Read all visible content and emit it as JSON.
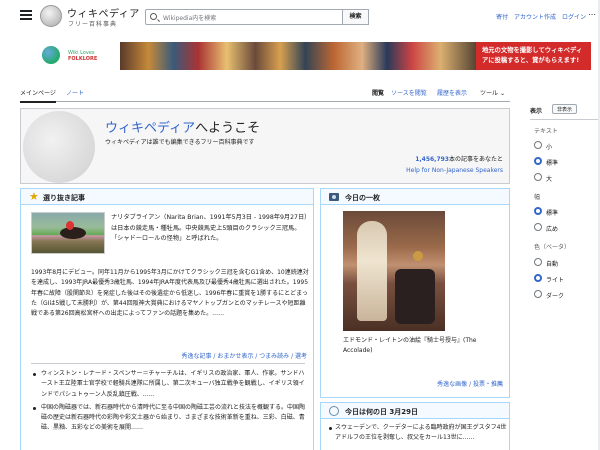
{
  "header": {
    "wordmark": "ウィキペディア",
    "tagline": "フリー百科事典",
    "search_placeholder": "Wikipedia内を検索",
    "search_button": "検索",
    "links": [
      "寄付",
      "アカウント作成",
      "ログイン"
    ]
  },
  "banner": {
    "logo_text_1": "Wiki Loves",
    "logo_text_2": "FOLKLORE",
    "campaign_text": "地元の文物を撮影してウィキペディアに投稿すると、賞がもらえます!"
  },
  "tabs": {
    "main": "メインページ",
    "talk": "ノート",
    "read": "閲覧",
    "source": "ソースを閲覧",
    "history": "履歴を表示",
    "tools": "ツール"
  },
  "welcome": {
    "title_prefix": "ウィキペディア",
    "title_suffix": "へようこそ",
    "subtitle": "ウィキペディアは誰でも編集できるフリー百科事典です",
    "article_count": "1,456,793",
    "count_suffix": "本の記事をあなたと",
    "non_japanese": "Help for Non-Japanese Speakers"
  },
  "featured": {
    "heading": "選り抜き記事",
    "intro": "ナリタブライアン（Narita Brian、1991年5月3日 - 1998年9月27日）は日本の競走馬・種牡馬。中央競馬史上5頭目のクラシック三冠馬。「シャドーロールの怪物」と呼ばれた。",
    "body": "1993年8月にデビュー。同年11月から1995年3月にかけてクラシック三冠を含むG1含め、10連続連対を達成し、1993年JRA最優秀3歳牡馬、1994年JRA年度代表馬及び最優秀4歳牡馬に選出された。1995年春に故障（股関節炎）を発症した後はその後遺症から低迷し、1996年春に重賞を1勝するにとどまった（GIは5戦して未勝利）が、第44回阪神大賞典におけるマヤノトップガンとのマッチレースや短距離戦である第26回高松宮杯への出走によってファンの話題を集めた。……",
    "more_links": "秀逸な記事 / おまかせ表示 / つまみ読み / 選考",
    "news": [
      "ウィンストン・レナード・スペンサー＝チャーチルは、イギリスの政治家、軍人、作家。サンドハースト王立陸軍士官学校で軽騎兵連隊に所属し、第二次キューバ独立戦争を観戦し、イギリス領インドでパシュトゥーン人反乱鎮圧戦、……",
      "中国の陶磁器では、新石器時代から清時代に至る中国の陶磁工芸の流れと技法を概観する。中国陶磁の歴史は新石器時代の彩陶や彩文土器から始まり、さまざまな技術革新を重ね、三彩、白磁、青磁、黒釉、五彩などの美術を展開……"
    ]
  },
  "image_of_day": {
    "heading": "今日の一枚",
    "caption": "エドモンド・レイトンの油絵『騎士号授与』(The Accolade)",
    "more_links": "秀逸な画像 / 投票・推薦"
  },
  "on_this_day": {
    "heading": "今日は何の日 3月29日",
    "text": "スウェーデンで、クーデターによる臨時政府が国王グスタフ4世アドルフの王位を剥奪し、叔父をカール13世に……"
  },
  "appearance": {
    "heading": "表示",
    "hide": "非表示",
    "text_label": "テキスト",
    "text_options": [
      "小",
      "標準",
      "大"
    ],
    "width_label": "幅",
    "width_options": [
      "標準",
      "広め"
    ],
    "color_label": "色（ベータ）",
    "color_options": [
      "自動",
      "ライト",
      "ダーク"
    ]
  }
}
